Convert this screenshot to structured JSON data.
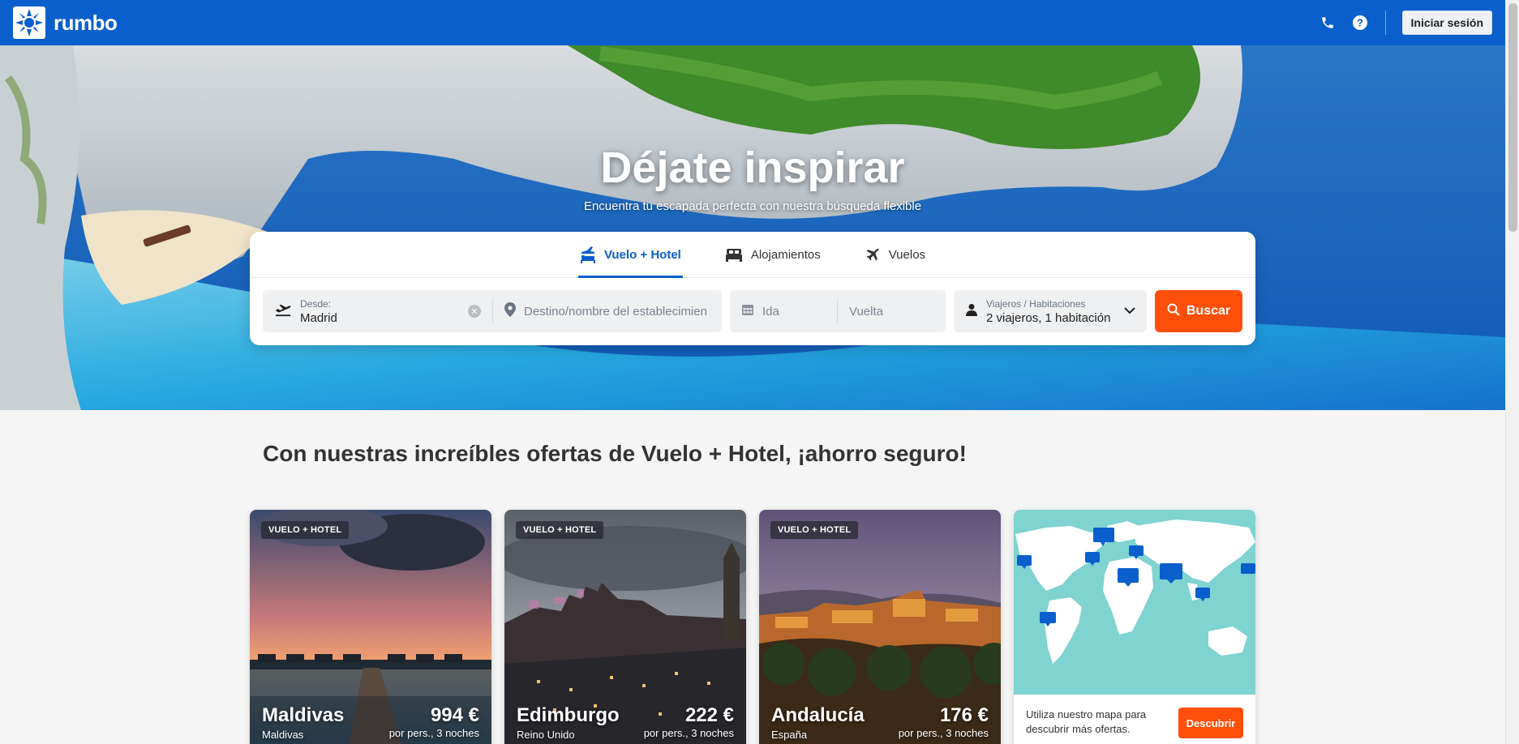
{
  "brand": {
    "name": "rumbo",
    "accent": "#0a5fcc",
    "cta": "#ff4f0a"
  },
  "header": {
    "phone_icon": "phone-icon",
    "help_icon": "help-icon",
    "login_label": "Iniciar sesión"
  },
  "hero": {
    "title": "Déjate inspirar",
    "subtitle": "Encuentra tu escapada perfecta con nuestra búsqueda flexible"
  },
  "search": {
    "tabs": [
      {
        "label": "Vuelo + Hotel",
        "icon": "flight-hotel-icon",
        "active": true
      },
      {
        "label": "Alojamientos",
        "icon": "bed-icon",
        "active": false
      },
      {
        "label": "Vuelos",
        "icon": "plane-icon",
        "active": false
      }
    ],
    "origin_label": "Desde:",
    "origin_value": "Madrid",
    "destination_placeholder": "Destino/nombre del establecimiento",
    "departure_placeholder": "Ida",
    "return_placeholder": "Vuelta",
    "travellers_label": "Viajeros / Habitaciones",
    "travellers_value": "2 viajeros, 1 habitación",
    "search_label": "Buscar"
  },
  "offers": {
    "title": "Con nuestras increíbles ofertas de Vuelo + Hotel, ¡ahorro seguro!",
    "cards": [
      {
        "badge": "VUELO + HOTEL",
        "name": "Maldivas",
        "country": "Maldivas",
        "price": "994 €",
        "per": "por pers., 3 noches"
      },
      {
        "badge": "VUELO + HOTEL",
        "name": "Edimburgo",
        "country": "Reino Unido",
        "price": "222 €",
        "per": "por pers., 3 noches"
      },
      {
        "badge": "VUELO + HOTEL",
        "name": "Andalucía",
        "country": "España",
        "price": "176 €",
        "per": "por pers., 3 noches"
      }
    ],
    "map_card": {
      "text": "Utiliza nuestro mapa para descubrir más ofertas.",
      "button": "Descubrir"
    }
  }
}
